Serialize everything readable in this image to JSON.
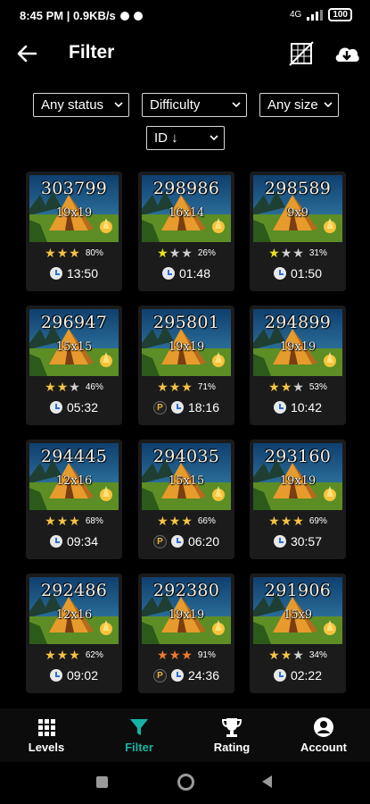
{
  "status_bar": {
    "time_speed": "8:45 PM | 0.9KB/s",
    "network": "4G",
    "battery": "100"
  },
  "app_bar": {
    "title": "Filter",
    "back_icon": "arrow-left-icon",
    "action_icons": [
      "sudoku-grid-icon",
      "cloud-download-icon"
    ]
  },
  "filters": {
    "status": "Any status",
    "difficulty": "Difficulty",
    "size": "Any size",
    "sort": "ID ↓"
  },
  "colors": {
    "background": "#000000",
    "card": "#1b1b1b",
    "star_gold": "#f6c343",
    "star_orange": "#f07a2e",
    "star_yellow": "#e8e21f",
    "star_empty": "#d0d0d0",
    "accent": "#16b3a5"
  },
  "puzzles": [
    {
      "id": "303799",
      "size": "19x19",
      "stars": [
        "gold",
        "gold",
        "gold"
      ],
      "percent": "80%",
      "time": "13:50",
      "badge": ""
    },
    {
      "id": "298986",
      "size": "16x14",
      "stars": [
        "yellow",
        "empty",
        "empty"
      ],
      "percent": "26%",
      "time": "01:48",
      "badge": ""
    },
    {
      "id": "298589",
      "size": "9x9",
      "stars": [
        "yellow",
        "empty",
        "empty"
      ],
      "percent": "31%",
      "time": "01:50",
      "badge": ""
    },
    {
      "id": "296947",
      "size": "15x15",
      "stars": [
        "gold",
        "gold",
        "empty"
      ],
      "percent": "46%",
      "time": "05:32",
      "badge": ""
    },
    {
      "id": "295801",
      "size": "19x19",
      "stars": [
        "gold",
        "gold",
        "gold"
      ],
      "percent": "71%",
      "time": "18:16",
      "badge": "P"
    },
    {
      "id": "294899",
      "size": "19x19",
      "stars": [
        "gold",
        "gold",
        "empty"
      ],
      "percent": "53%",
      "time": "10:42",
      "badge": ""
    },
    {
      "id": "294445",
      "size": "12x16",
      "stars": [
        "gold",
        "gold",
        "gold"
      ],
      "percent": "68%",
      "time": "09:34",
      "badge": ""
    },
    {
      "id": "294035",
      "size": "15x15",
      "stars": [
        "gold",
        "gold",
        "gold"
      ],
      "percent": "66%",
      "time": "06:20",
      "badge": "P"
    },
    {
      "id": "293160",
      "size": "19x19",
      "stars": [
        "gold",
        "gold",
        "gold"
      ],
      "percent": "69%",
      "time": "30:57",
      "badge": ""
    },
    {
      "id": "292486",
      "size": "12x16",
      "stars": [
        "gold",
        "gold",
        "gold"
      ],
      "percent": "62%",
      "time": "09:02",
      "badge": ""
    },
    {
      "id": "292380",
      "size": "19x19",
      "stars": [
        "orange",
        "orange",
        "orange"
      ],
      "percent": "91%",
      "time": "24:36",
      "badge": "P"
    },
    {
      "id": "291906",
      "size": "15x9",
      "stars": [
        "gold",
        "gold",
        "empty"
      ],
      "percent": "34%",
      "time": "02:22",
      "badge": ""
    }
  ],
  "bottom_nav": [
    {
      "label": "Levels",
      "icon": "grid-icon",
      "active": false
    },
    {
      "label": "Filter",
      "icon": "filter-icon",
      "active": true
    },
    {
      "label": "Rating",
      "icon": "trophy-icon",
      "active": false
    },
    {
      "label": "Account",
      "icon": "account-icon",
      "active": false
    }
  ]
}
